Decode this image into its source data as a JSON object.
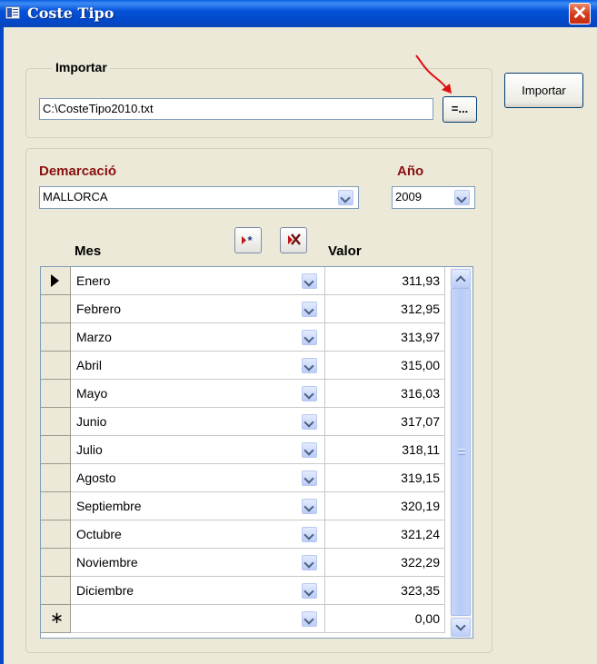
{
  "window": {
    "title": "Coste Tipo",
    "close_glyph": "✕"
  },
  "import_group": {
    "label": "Importar",
    "path_value": "C:\\CosteTipo2010.txt",
    "browse_label": "=..."
  },
  "import_button_label": "Importar",
  "filters": {
    "demarcacion_label": "Demarcació",
    "demarcacion_value": "MALLORCA",
    "ano_label": "Año",
    "ano_value": "2009"
  },
  "grid": {
    "col_mes": "Mes",
    "col_valor": "Valor",
    "rows": [
      {
        "mes": "Enero",
        "valor": "311,93"
      },
      {
        "mes": "Febrero",
        "valor": "312,95"
      },
      {
        "mes": "Marzo",
        "valor": "313,97"
      },
      {
        "mes": "Abril",
        "valor": "315,00"
      },
      {
        "mes": "Mayo",
        "valor": "316,03"
      },
      {
        "mes": "Junio",
        "valor": "317,07"
      },
      {
        "mes": "Julio",
        "valor": "318,11"
      },
      {
        "mes": "Agosto",
        "valor": "319,15"
      },
      {
        "mes": "Septiembre",
        "valor": "320,19"
      },
      {
        "mes": "Octubre",
        "valor": "321,24"
      },
      {
        "mes": "Noviembre",
        "valor": "322,29"
      },
      {
        "mes": "Diciembre",
        "valor": "323,35"
      }
    ],
    "new_row": {
      "marker": "∗",
      "mes": "",
      "valor": "0,00"
    },
    "selected_row_index": 0
  },
  "icons": {
    "title": "form-window-icon",
    "add_record": "new-record-icon",
    "delete_record": "delete-record-icon",
    "annotation": "red-arrow-annotation"
  },
  "colors": {
    "titlebar": "#0553d8",
    "label_red": "#8b1010",
    "annotation_red": "#e01010"
  }
}
